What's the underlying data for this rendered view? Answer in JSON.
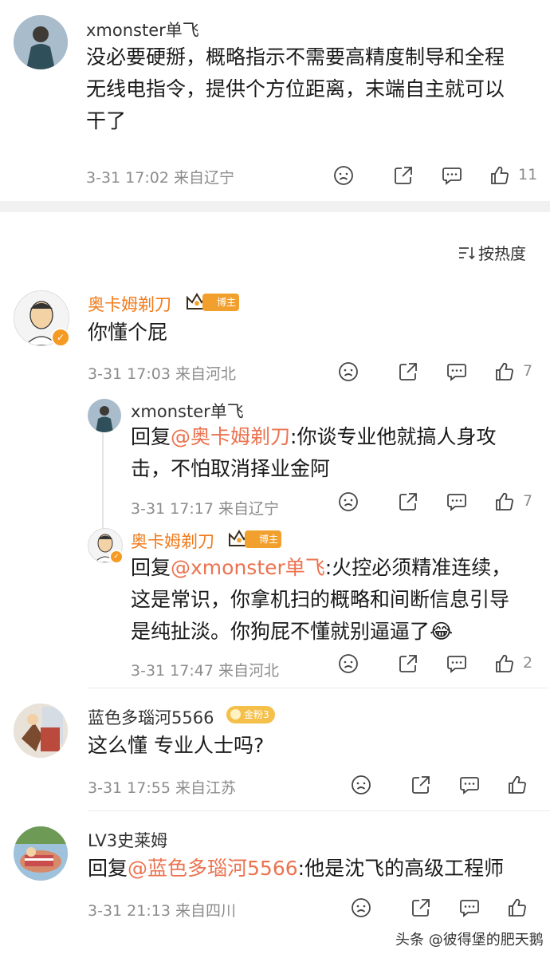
{
  "top_comment": {
    "username": "xmonster单飞",
    "lines": [
      "没必要硬掰，概略指示不需要高精度制导和全程",
      "无线电指令，提供个方位距离，末端自主就可以",
      "干了"
    ],
    "meta": "3-31 17:02  来自辽宁",
    "likes": "11"
  },
  "sort": {
    "label": "按热度"
  },
  "comments": [
    {
      "username": "奥卡姆剃刀",
      "badge": "博主",
      "text": "你懂个屁",
      "meta": "3-31 17:03  来自河北",
      "likes": "7",
      "replies": [
        {
          "username": "xmonster单飞",
          "reply_prefix": "回复",
          "mention": "@奥卡姆剃刀",
          "line1": ":你谈专业他就搞人身攻",
          "line2": "击，不怕取消择业金阿",
          "meta": "3-31 17:17  来自辽宁",
          "likes": "7"
        },
        {
          "username": "奥卡姆剃刀",
          "badge": "博主",
          "reply_prefix": "回复",
          "mention": "@xmonster单飞",
          "line1": ":火控必须精准连续，",
          "line2": "这是常识，你拿机扫的概略和间断信息引导",
          "line3": "是纯扯淡。你狗屁不懂就别逼逼了",
          "emoji": "😂",
          "meta": "3-31 17:47  来自河北",
          "likes": "2"
        }
      ]
    },
    {
      "username": "蓝色多瑙河5566",
      "fan_badge": "金粉3",
      "text": "这么懂 专业人士吗?",
      "meta": "3-31 17:55  来自江苏",
      "likes": ""
    },
    {
      "username": "LV3史莱姆",
      "reply_prefix": "回复",
      "mention": "@蓝色多瑙河5566",
      "rest": ":他是沈飞的高级工程师",
      "meta": "3-31 21:13  来自四川",
      "likes": ""
    }
  ],
  "watermark": "头条 @彼得堡的肥天鹅",
  "icons": {
    "dislike": "sad-face-icon",
    "share": "share-icon",
    "comment": "comment-icon",
    "like": "thumbs-up-icon"
  }
}
